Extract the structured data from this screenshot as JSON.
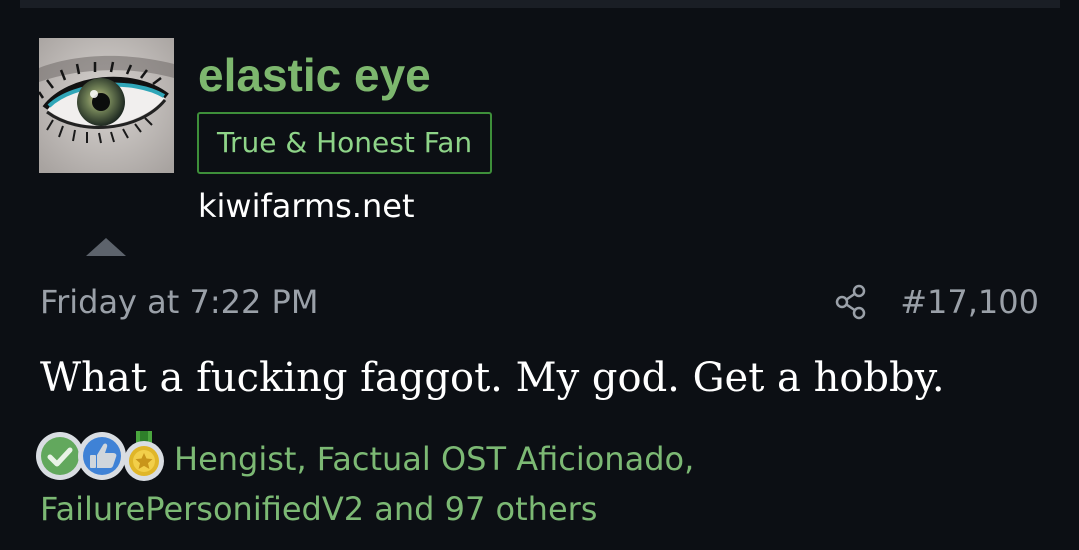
{
  "post": {
    "author": {
      "username": "elastic eye",
      "user_title": "True & Honest Fan",
      "site": "kiwifarms.net",
      "avatar_icon": "eye-avatar"
    },
    "date": "Friday at 7:22 PM",
    "post_number": "#17,100",
    "body": "What a fucking faggot. My god. Get a hobby.",
    "reactions": {
      "icons": [
        "check-reaction-icon",
        "thumbs-up-reaction-icon",
        "medal-reaction-icon"
      ],
      "reactors_text": "Hengist, Factual OST Aficionado, FailurePersonifiedV2 and 97 others"
    }
  },
  "colors": {
    "background": "#0c0f14",
    "username": "#7db76e",
    "title_border": "#3e8f3a",
    "title_text": "#8ed488",
    "meta_text": "#9aa0a8",
    "reactors_text": "#7cb974"
  }
}
